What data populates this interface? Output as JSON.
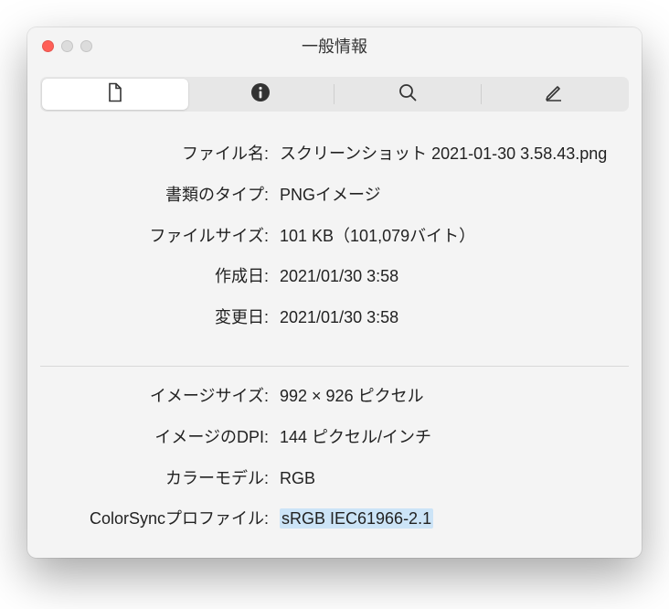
{
  "window": {
    "title": "一般情報"
  },
  "tabs": {
    "document": "document-icon",
    "info": "info-icon",
    "search": "search-icon",
    "edit": "edit-icon"
  },
  "section1": {
    "filename_label": "ファイル名:",
    "filename_value": "スクリーンショット 2021-01-30 3.58.43.png",
    "doctype_label": "書類のタイプ:",
    "doctype_value": "PNGイメージ",
    "filesize_label": "ファイルサイズ:",
    "filesize_value": "101 KB（101,079バイト）",
    "created_label": "作成日:",
    "created_value": "2021/01/30 3:58",
    "modified_label": "変更日:",
    "modified_value": "2021/01/30 3:58"
  },
  "section2": {
    "imagesize_label": "イメージサイズ:",
    "imagesize_value": "992 × 926 ピクセル",
    "dpi_label": "イメージのDPI:",
    "dpi_value": "144 ピクセル/インチ",
    "colormodel_label": "カラーモデル:",
    "colormodel_value": "RGB",
    "colorsync_label": "ColorSyncプロファイル:",
    "colorsync_value": "sRGB IEC61966-2.1"
  }
}
